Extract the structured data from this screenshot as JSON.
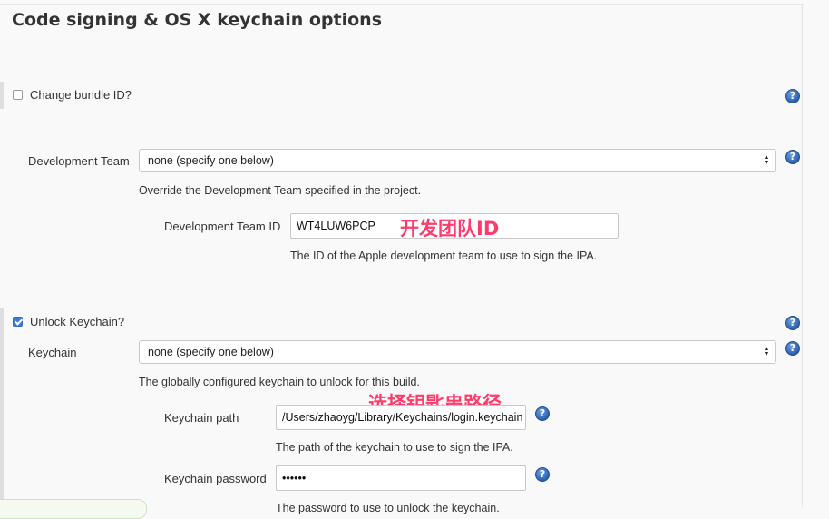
{
  "section": {
    "title": "Code signing & OS X keychain options"
  },
  "bundle": {
    "checkbox_label": "Change bundle ID?",
    "checked": false
  },
  "dev_team": {
    "label": "Development Team",
    "select_value": "none (specify one below)",
    "description": "Override the Development Team specified in the project.",
    "id_label": "Development Team ID",
    "id_value": "WT4LUW6PCP",
    "id_description": "The ID of the Apple development team to use to sign the IPA."
  },
  "keychain": {
    "checkbox_label": "Unlock Keychain?",
    "checked": true,
    "label": "Keychain",
    "select_value": "none (specify one below)",
    "description": "The globally configured keychain to unlock for this build.",
    "path_label": "Keychain path",
    "path_value": "/Users/zhaoyg/Library/Keychains/login.keychain",
    "path_description": "The path of the keychain to use to sign the IPA.",
    "password_label": "Keychain password",
    "password_value": "••••••",
    "password_description": "The password to use to unlock the keychain."
  },
  "annotations": {
    "team_id_note": "开发团队ID",
    "keychain_path_note": "选择钥匙串路径"
  },
  "icons": {
    "help": "?",
    "select_arrows": "▲▼"
  },
  "colors": {
    "annotation": "#ff3b6b",
    "help_icon": "#2c5fae",
    "checkbox_checked": "#3b7ed6"
  }
}
